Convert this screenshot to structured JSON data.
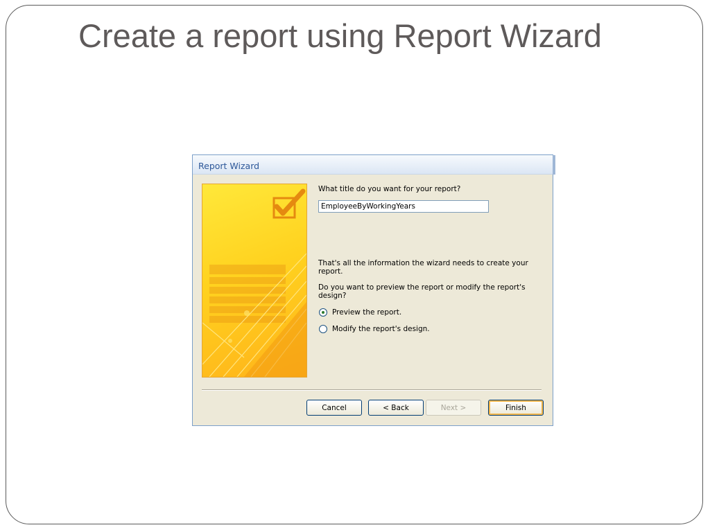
{
  "slide": {
    "title": "Create a report using Report Wizard"
  },
  "wizard": {
    "window_title": "Report Wizard",
    "title_prompt": "What title do you want for your report?",
    "title_value": "EmployeeByWorkingYears",
    "info_text": "That's all the information the wizard needs to create your report.",
    "question_text": "Do you want to preview the report or modify the report's design?",
    "options": [
      {
        "label": "Preview the report.",
        "selected": true
      },
      {
        "label": "Modify the report's design.",
        "selected": false
      }
    ],
    "buttons": {
      "cancel": "Cancel",
      "back": "< Back",
      "next": "Next >",
      "finish": "Finish"
    },
    "colors": {
      "accent": "#2d5899",
      "art_yellow": "#ffd21f",
      "art_orange": "#ffb31a"
    },
    "icons": {
      "side_art": "report-wizard-checkmark-art"
    }
  }
}
